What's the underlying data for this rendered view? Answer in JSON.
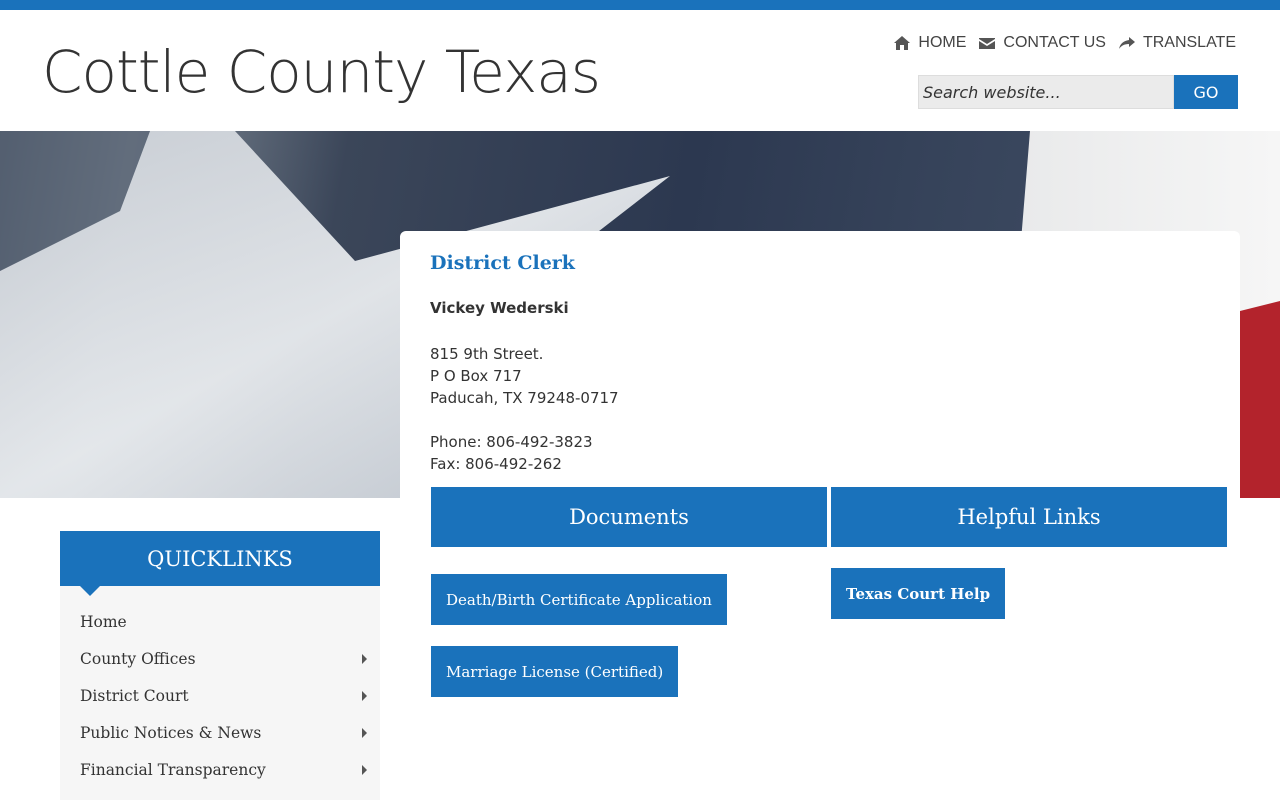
{
  "header": {
    "site_title": "Cottle County Texas",
    "nav": [
      {
        "label": "HOME",
        "icon": "home-icon"
      },
      {
        "label": "CONTACT US",
        "icon": "envelope-icon"
      },
      {
        "label": "TRANSLATE",
        "icon": "share-arrow-icon"
      }
    ],
    "search": {
      "placeholder": "Search website...",
      "button_label": "GO"
    }
  },
  "colors": {
    "accent": "#1a72bb",
    "text": "#333333",
    "sidebar_bg": "#f6f6f6"
  },
  "office": {
    "title": "District Clerk",
    "name": "Vickey Wederski",
    "address": [
      "815 9th Street.",
      "P O Box 717",
      "Paducah, TX 79248-0717"
    ],
    "phone": "Phone: 806-492-3823",
    "fax": "Fax: 806-492-262"
  },
  "documents": {
    "heading": "Documents",
    "links": [
      "Death/Birth Certificate Application",
      "Marriage License (Certified)"
    ]
  },
  "helpful_links": {
    "heading": "Helpful Links",
    "links": [
      "Texas Court Help"
    ]
  },
  "quicklinks": {
    "heading": "QUICKLINKS",
    "items": [
      {
        "label": "Home",
        "has_submenu": false
      },
      {
        "label": "County Offices",
        "has_submenu": true
      },
      {
        "label": "District Court",
        "has_submenu": true
      },
      {
        "label": "Public Notices & News",
        "has_submenu": true
      },
      {
        "label": "Financial Transparency",
        "has_submenu": true
      }
    ]
  }
}
